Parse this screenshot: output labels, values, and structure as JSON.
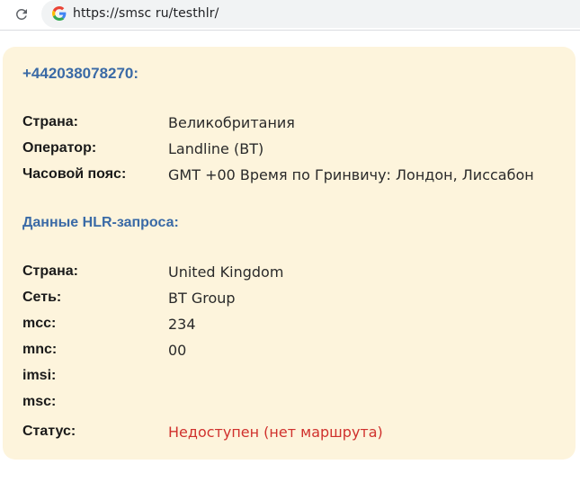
{
  "browser": {
    "url": "https://smsc ru/testhlr/"
  },
  "result": {
    "phone": "+442038078270:",
    "basic": [
      {
        "label": "Страна:",
        "value": "Великобритания"
      },
      {
        "label": "Оператор:",
        "value": "Landline (BT)"
      },
      {
        "label": "Часовой пояс:",
        "value": "GMT +00 Время по Гринвичу: Лондон, Лиссабон"
      }
    ],
    "hlr_title": "Данные HLR-запроса:",
    "hlr": [
      {
        "label": "Страна:",
        "value": "United Kingdom"
      },
      {
        "label": "Сеть:",
        "value": "BT Group"
      },
      {
        "label": "mcc:",
        "value": "234"
      },
      {
        "label": "mnc:",
        "value": "00"
      },
      {
        "label": "imsi:",
        "value": ""
      },
      {
        "label": "msc:",
        "value": ""
      }
    ],
    "status": {
      "label": "Статус:",
      "value": "Недоступен (нет маршрута)",
      "color": "#d0312d"
    }
  },
  "colors": {
    "card_bg": "#fdf4dc",
    "heading": "#3a6aa6"
  },
  "icons": {
    "reload": "reload-icon",
    "site": "google-g-icon"
  }
}
